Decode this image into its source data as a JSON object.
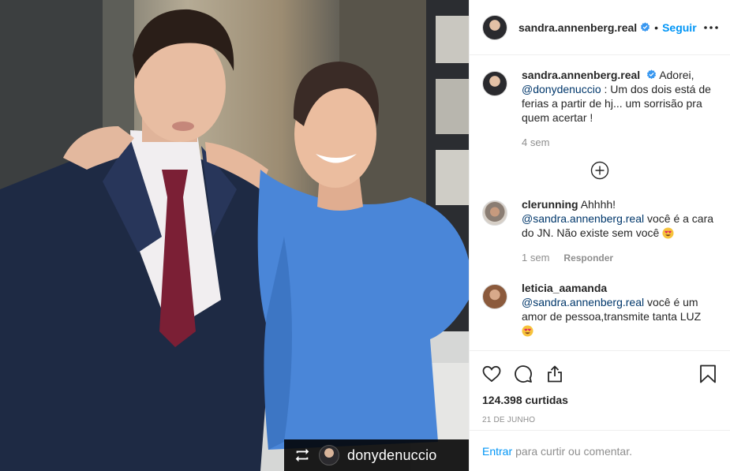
{
  "post": {
    "author": "sandra.annenberg.real",
    "follow_label": "Seguir",
    "dot": "•",
    "repost_credit": "donydenuccio"
  },
  "caption": {
    "user": "sandra.annenberg.real",
    "text_before": "Adorei,",
    "mention": "@donydenuccio",
    "text_after": ": Um dos dois está de ferias a partir de hj... um sorrisão pra quem acertar !",
    "time": "4 sem"
  },
  "comments": [
    {
      "user": "clerunning",
      "text_before": "Ahhhh!",
      "mention": "@sandra.annenberg.real",
      "text_after": "você é a cara do JN. Não existe sem você",
      "time": "1 sem",
      "reply_label": "Responder"
    },
    {
      "user": "leticia_aamanda",
      "mention": "@sandra.annenberg.real",
      "text_after": "você é um amor de pessoa,transmite tanta LUZ"
    }
  ],
  "likes": "124.398 curtidas",
  "date": "21 DE JUNHO",
  "login": {
    "link": "Entrar",
    "rest": "para curtir ou comentar."
  },
  "colors": {
    "accent": "#0095f6",
    "mention": "#00376b",
    "muted": "#8e8e8e",
    "verified": "#3897f0"
  },
  "icons": [
    "verified-badge-icon",
    "more-options-icon",
    "add-comment-icon",
    "heart-icon",
    "comment-icon",
    "share-icon",
    "bookmark-icon",
    "repost-icon",
    "heart-eyes-emoji-icon"
  ]
}
